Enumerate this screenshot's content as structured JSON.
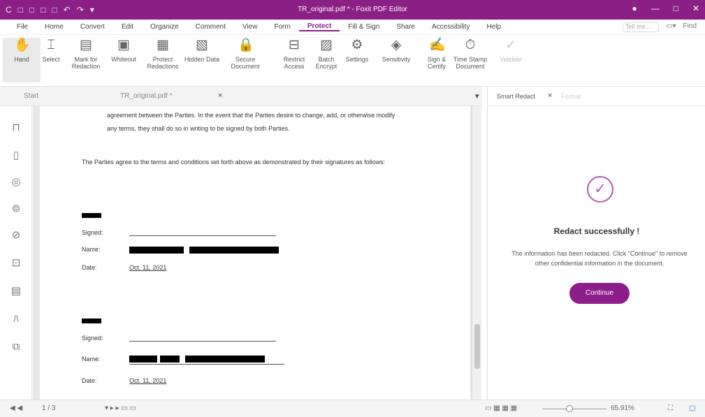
{
  "window": {
    "title": "TR_original.pdf * - Foxit PDF Editor",
    "quick_access": [
      "C",
      "□",
      "□",
      "□",
      "□",
      "↶",
      "↷",
      "▾"
    ],
    "controls": [
      "●",
      "—",
      "□",
      "✕"
    ]
  },
  "menu": {
    "items": [
      "File",
      "Home",
      "Convert",
      "Edit",
      "Organize",
      "Comment",
      "View",
      "Form",
      "Protect",
      "Fill & Sign",
      "Share",
      "Accessibility",
      "Help"
    ],
    "active": "Protect",
    "tell_me": "Tell me...",
    "find": "Find"
  },
  "ribbon": {
    "buttons": [
      {
        "label": "Hand",
        "icon": "✋"
      },
      {
        "label": "Select",
        "icon": "⌶"
      },
      {
        "label": "Mark for Redaction",
        "icon": "▤"
      },
      {
        "label": "Whiteout",
        "icon": "▣"
      },
      {
        "label": "Protect Redactions",
        "icon": "▦"
      },
      {
        "label": "Hidden Data",
        "icon": "▧"
      },
      {
        "label": "Secure Document",
        "icon": "🔒"
      },
      {
        "label": "Restrict Access",
        "icon": "⊟"
      },
      {
        "label": "Batch Encrypt",
        "icon": "▨"
      },
      {
        "label": "Settings",
        "icon": "⚙"
      },
      {
        "label": "Sensitivity",
        "icon": "◈"
      },
      {
        "label": "Sign & Certify",
        "icon": "✍"
      },
      {
        "label": "Time Stamp Document",
        "icon": "⏱"
      },
      {
        "label": "Validate",
        "icon": "✓"
      }
    ]
  },
  "tabs": {
    "start": "Start",
    "file": "TR_original.pdf *",
    "close": "×",
    "menu_arrow": "▾"
  },
  "sidebar_icons": [
    "bookmark-icon",
    "page-thumbnail-icon",
    "layers-icon",
    "security-icon",
    "attachment-icon",
    "stamp-icon",
    "form-icon",
    "signature-icon",
    "compare-icon"
  ],
  "document": {
    "para_line1": "agreement between the Parties. In the event that the Parties desire to change, add, or otherwise modify",
    "para_line2": "any terms, they shall do so in writing to be signed by both Parties.",
    "statement": "The Parties agree to the terms and conditions set forth above as demonstrated by their signatures as follows:",
    "block1": {
      "signed": "Signed:",
      "name": "Name:",
      "date": "Date:",
      "date_value": "Oct. 11, 2021"
    },
    "block2": {
      "signed": "Signed:",
      "name": "Name:",
      "date": "Date:",
      "date_value": "Oct. 11, 2021"
    }
  },
  "right_panel": {
    "title": "Smart Redact",
    "close": "×",
    "secondary_tab": "Format",
    "heading": "Redact successfully !",
    "message_line1": "The information has been redacted. Click \"Continue\" to remove",
    "message_line2": "other confidential information in the document.",
    "continue_label": "Continue",
    "check": "✓"
  },
  "status": {
    "page": "1 / 3",
    "zoom": "65.91%",
    "nav_icons": "◀ ◀",
    "view_icons": "▾ ▸ ▸ ▭ ▭",
    "layout_icons": "▭ ▦ ▦ ▦",
    "fit_icon": "⛶"
  }
}
